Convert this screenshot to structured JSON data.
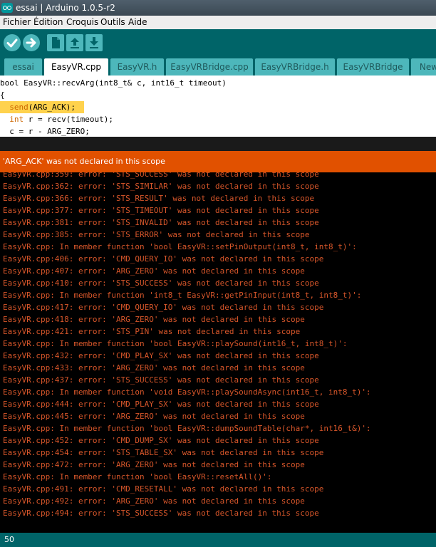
{
  "window": {
    "title": "essai | Arduino 1.0.5-r2"
  },
  "menu": [
    "Fichier",
    "Édition",
    "Croquis",
    "Outils",
    "Aide"
  ],
  "toolbar": {
    "icons": [
      "verify-check-icon",
      "upload-arrow-icon",
      "new-file-icon",
      "open-arrow-up-icon",
      "save-arrow-down-icon"
    ],
    "accent": "#006468",
    "button_color": "#4db7bb"
  },
  "tabs": [
    {
      "label": "essai",
      "active": false
    },
    {
      "label": "EasyVR.cpp",
      "active": true
    },
    {
      "label": "EasyVR.h",
      "active": false
    },
    {
      "label": "EasyVRBridge.cpp",
      "active": false
    },
    {
      "label": "EasyVRBridge.h",
      "active": false
    },
    {
      "label": "EasyVRBridge",
      "active": false
    },
    {
      "label": "New",
      "active": false
    }
  ],
  "editor": {
    "lines": [
      "bool EasyVR::recvArg(int8_t& c, int16_t timeout)",
      "{",
      "  send(ARG_ACK);",
      "  int r = recv(timeout);",
      "  c = r - ARG_ZERO;"
    ],
    "highlight_color": "#ffd24d"
  },
  "status": {
    "message": "'ARG_ACK' was not declared in this scope",
    "color": "#e15100"
  },
  "console": {
    "color": "#d7562a",
    "lines": [
      "EasyVR.cpp:359: error: 'STS_SUCCESS' was not declared in this scope",
      "EasyVR.cpp:362: error: 'STS_SIMILAR' was not declared in this scope",
      "EasyVR.cpp:366: error: 'STS_RESULT' was not declared in this scope",
      "EasyVR.cpp:377: error: 'STS_TIMEOUT' was not declared in this scope",
      "EasyVR.cpp:381: error: 'STS_INVALID' was not declared in this scope",
      "EasyVR.cpp:385: error: 'STS_ERROR' was not declared in this scope",
      "EasyVR.cpp: In member function 'bool EasyVR::setPinOutput(int8_t, int8_t)':",
      "EasyVR.cpp:406: error: 'CMD_QUERY_IO' was not declared in this scope",
      "EasyVR.cpp:407: error: 'ARG_ZERO' was not declared in this scope",
      "EasyVR.cpp:410: error: 'STS_SUCCESS' was not declared in this scope",
      "EasyVR.cpp: In member function 'int8_t EasyVR::getPinInput(int8_t, int8_t)':",
      "EasyVR.cpp:417: error: 'CMD_QUERY_IO' was not declared in this scope",
      "EasyVR.cpp:418: error: 'ARG_ZERO' was not declared in this scope",
      "EasyVR.cpp:421: error: 'STS_PIN' was not declared in this scope",
      "EasyVR.cpp: In member function 'bool EasyVR::playSound(int16_t, int8_t)':",
      "EasyVR.cpp:432: error: 'CMD_PLAY_SX' was not declared in this scope",
      "EasyVR.cpp:433: error: 'ARG_ZERO' was not declared in this scope",
      "EasyVR.cpp:437: error: 'STS_SUCCESS' was not declared in this scope",
      "EasyVR.cpp: In member function 'void EasyVR::playSoundAsync(int16_t, int8_t)':",
      "EasyVR.cpp:444: error: 'CMD_PLAY_SX' was not declared in this scope",
      "EasyVR.cpp:445: error: 'ARG_ZERO' was not declared in this scope",
      "EasyVR.cpp: In member function 'bool EasyVR::dumpSoundTable(char*, int16_t&)':",
      "EasyVR.cpp:452: error: 'CMD_DUMP_SX' was not declared in this scope",
      "EasyVR.cpp:454: error: 'STS_TABLE_SX' was not declared in this scope",
      "EasyVR.cpp:472: error: 'ARG_ZERO' was not declared in this scope",
      "EasyVR.cpp: In member function 'bool EasyVR::resetAll()':",
      "EasyVR.cpp:491: error: 'CMD_RESETALL' was not declared in this scope",
      "EasyVR.cpp:492: error: 'ARG_ZERO' was not declared in this scope",
      "EasyVR.cpp:494: error: 'STS_SUCCESS' was not declared in this scope"
    ]
  },
  "footer": {
    "line_number": "50"
  }
}
